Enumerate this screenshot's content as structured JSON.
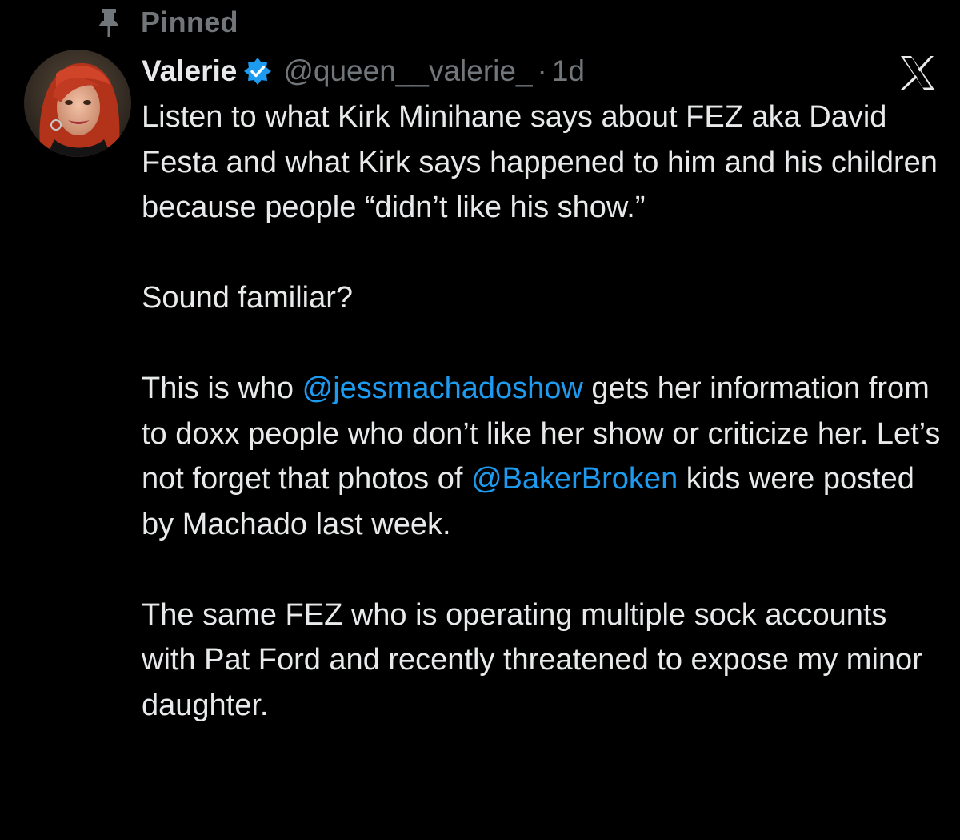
{
  "pinned": {
    "label": "Pinned"
  },
  "author": {
    "display_name": "Valerie",
    "handle": "@queen__valerie_",
    "separator": "·",
    "timestamp": "1d",
    "verified": true
  },
  "brand": {
    "logo": "x-logo"
  },
  "colors": {
    "background": "#000000",
    "text": "#e7e9ea",
    "secondary_text": "#71767b",
    "link": "#1d9bf0",
    "verified_badge": "#1d9bf0"
  },
  "tweet": {
    "p1": "Listen to what Kirk Minihane says about FEZ aka David Festa and what Kirk says happened to him and his children because people “didn’t like his show.”",
    "p2": "Sound familiar?",
    "p3": {
      "before": "This is who ",
      "mention1": "@jessmachadoshow",
      "middle": " gets her information from to doxx people who don’t like her show or criticize her. Let’s not forget that photos of ",
      "mention2": "@BakerBroken",
      "after": " kids were posted by Machado last week."
    },
    "p4": "The same FEZ who is operating multiple sock accounts with Pat Ford and recently threatened to expose my minor daughter."
  }
}
